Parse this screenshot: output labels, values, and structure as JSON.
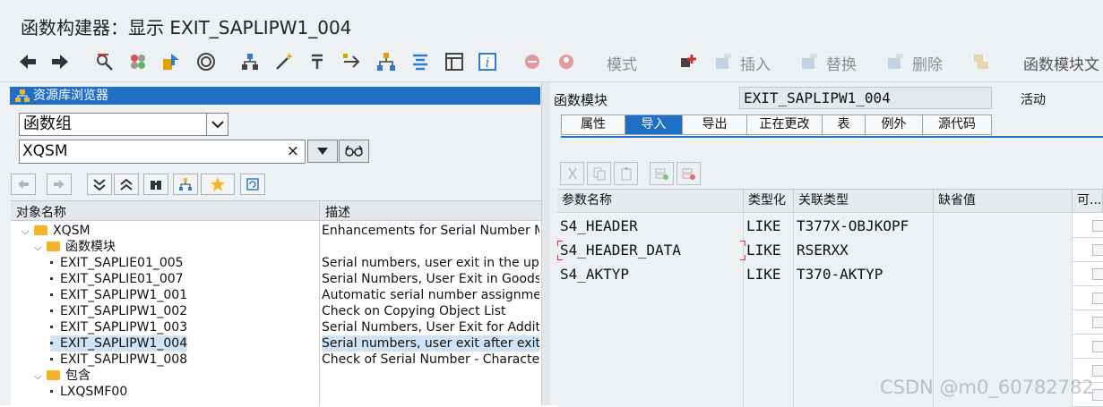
{
  "window": {
    "title": "函数构建器：显示 EXIT_SAPLIPW1_004"
  },
  "toolbar": {
    "pattern_label": "模式",
    "insert_label": "插入",
    "replace_label": "替换",
    "delete_label": "删除",
    "fm_doc_label": "函数模块文"
  },
  "left": {
    "repo_title": "资源库浏览器",
    "object_type": "函数组",
    "object_name": "XQSM",
    "clear_icon": "×",
    "columns": {
      "name": "对象名称",
      "desc": "描述"
    },
    "tree": [
      {
        "name": "XQSM",
        "desc": "Enhancements for Serial Number Mgt",
        "level": 0,
        "kind": "folder",
        "expanded": true
      },
      {
        "name": "函数模块",
        "desc": "",
        "level": 1,
        "kind": "folder",
        "expanded": true
      },
      {
        "name": "EXIT_SAPLIE01_005",
        "desc": "Serial numbers, user exit in the updat",
        "level": 2,
        "kind": "item"
      },
      {
        "name": "EXIT_SAPLIE01_007",
        "desc": "Serial Numbers, User Exit in Goods M",
        "level": 2,
        "kind": "item"
      },
      {
        "name": "EXIT_SAPLIPW1_001",
        "desc": "Automatic serial number assignment",
        "level": 2,
        "kind": "item"
      },
      {
        "name": "EXIT_SAPLIPW1_002",
        "desc": "Check on Copying Object List",
        "level": 2,
        "kind": "item"
      },
      {
        "name": "EXIT_SAPLIPW1_003",
        "desc": "Serial Numbers, User Exit for Addition",
        "level": 2,
        "kind": "item"
      },
      {
        "name": "EXIT_SAPLIPW1_004",
        "desc": "Serial numbers, user exit after exiting",
        "level": 2,
        "kind": "item",
        "selected": true
      },
      {
        "name": "EXIT_SAPLIPW1_008",
        "desc": "Check of Serial Number - Character S",
        "level": 2,
        "kind": "item"
      },
      {
        "name": "包含",
        "desc": "",
        "level": 1,
        "kind": "folder",
        "expanded": true
      },
      {
        "name": "LXQSMF00",
        "desc": "",
        "level": 2,
        "kind": "item"
      }
    ]
  },
  "right": {
    "fm_label": "函数模块",
    "fm_value": "EXIT_SAPLIPW1_004",
    "status": "活动",
    "tabs": [
      "属性",
      "导入",
      "导出",
      "正在更改",
      "表",
      "例外",
      "源代码"
    ],
    "active_tab": 1,
    "grid": {
      "headers": [
        "参数名称",
        "类型化",
        "关联类型",
        "缺省值",
        "可..."
      ],
      "rows": [
        [
          "S4_HEADER",
          "LIKE",
          "T377X-OBJKOPF",
          ""
        ],
        [
          "S4_HEADER_DATA",
          "LIKE",
          "RSERXX",
          ""
        ],
        [
          "S4_AKTYP",
          "LIKE",
          "T370-AKTYP",
          ""
        ],
        [
          "",
          "",
          "",
          ""
        ],
        [
          "",
          "",
          "",
          ""
        ],
        [
          "",
          "",
          "",
          ""
        ],
        [
          "",
          "",
          "",
          ""
        ],
        [
          "",
          "",
          "",
          ""
        ]
      ]
    }
  },
  "watermark": "CSDN @m0_60782782"
}
